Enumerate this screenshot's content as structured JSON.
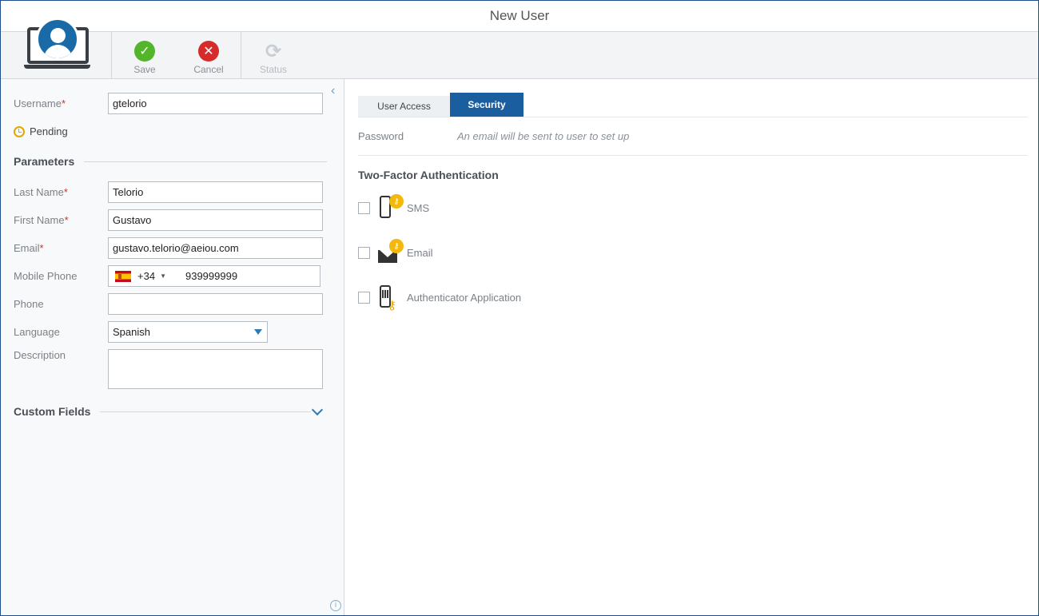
{
  "window": {
    "title": "New User"
  },
  "toolbar": {
    "save_label": "Save",
    "cancel_label": "Cancel",
    "status_label": "Status"
  },
  "left": {
    "username_label": "Username",
    "username_value": "gtelorio",
    "status_text": "Pending",
    "parameters_title": "Parameters",
    "last_name_label": "Last Name",
    "last_name_value": "Telorio",
    "first_name_label": "First Name",
    "first_name_value": "Gustavo",
    "email_label": "Email",
    "email_value": "gustavo.telorio@aeiou.com",
    "mobile_label": "Mobile Phone",
    "mobile_code": "+34",
    "mobile_value": "939999999",
    "phone_label": "Phone",
    "phone_value": "",
    "language_label": "Language",
    "language_value": "Spanish",
    "description_label": "Description",
    "description_value": "",
    "custom_fields_title": "Custom Fields",
    "required_marker": "*"
  },
  "right": {
    "tabs": [
      {
        "label": "User Access",
        "active": false
      },
      {
        "label": "Security",
        "active": true
      }
    ],
    "password_label": "Password",
    "password_value": "An email will be sent to user to set up",
    "tfa_title": "Two-Factor Authentication",
    "options": [
      {
        "label": "SMS",
        "checked": false
      },
      {
        "label": "Email",
        "checked": false
      },
      {
        "label": "Authenticator Application",
        "checked": false
      }
    ]
  },
  "colors": {
    "accent": "#1a5ea0",
    "save": "#52b52a",
    "cancel": "#d52b2b",
    "key": "#f2b90c",
    "required": "#c0392b"
  }
}
